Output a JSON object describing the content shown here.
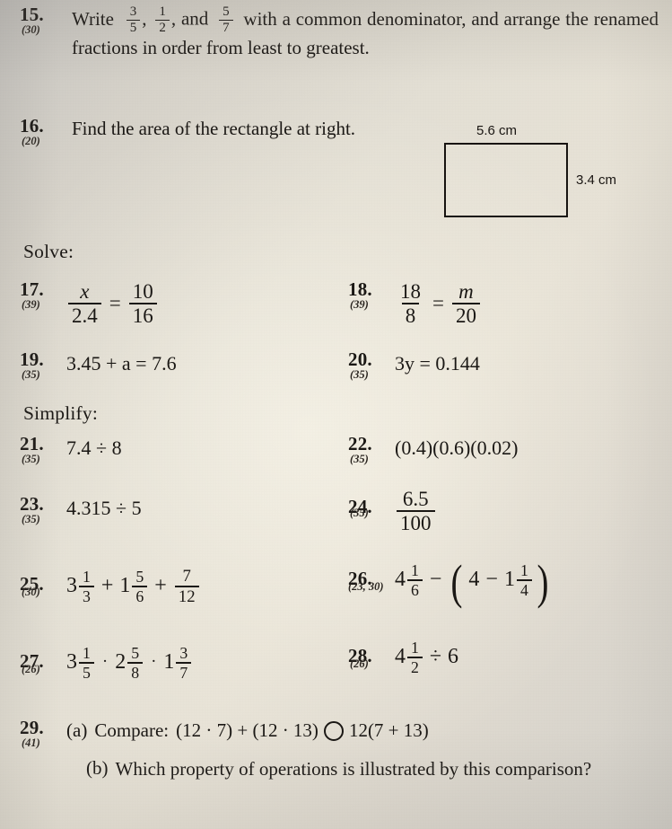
{
  "page": {
    "sections": {
      "solve_heading": "Solve:",
      "simplify_heading": "Simplify:"
    }
  },
  "problems": {
    "p15": {
      "number": "15.",
      "ref": "(30)",
      "text_lead": "Write",
      "frac1": {
        "num": "3",
        "den": "5"
      },
      "sep1": ",",
      "frac2": {
        "num": "1",
        "den": "2"
      },
      "sep2": ", and",
      "frac3": {
        "num": "5",
        "den": "7"
      },
      "text_rest": "with a common denominator, and arrange the renamed fractions in order from least to greatest."
    },
    "p16": {
      "number": "16.",
      "ref": "(20)",
      "text": "Find the area of the rectangle at right.",
      "figure": {
        "top_label": "5.6 cm",
        "right_label": "3.4 cm"
      }
    },
    "p17": {
      "number": "17.",
      "ref": "(39)",
      "lhs": {
        "num": "x",
        "den": "2.4"
      },
      "equals": "=",
      "rhs": {
        "num": "10",
        "den": "16"
      }
    },
    "p18": {
      "number": "18.",
      "ref": "(39)",
      "lhs": {
        "num": "18",
        "den": "8"
      },
      "equals": "=",
      "rhs": {
        "num": "m",
        "den": "20"
      }
    },
    "p19": {
      "number": "19.",
      "ref": "(35)",
      "expr": "3.45 + a = 7.6"
    },
    "p20": {
      "number": "20.",
      "ref": "(35)",
      "expr": "3y = 0.144"
    },
    "p21": {
      "number": "21.",
      "ref": "(35)",
      "expr": "7.4 ÷ 8"
    },
    "p22": {
      "number": "22.",
      "ref": "(35)",
      "expr": "(0.4)(0.6)(0.02)"
    },
    "p23": {
      "number": "23.",
      "ref": "(35)",
      "expr": "4.315 ÷ 5"
    },
    "p24": {
      "number": "24.",
      "ref": "(35)",
      "frac": {
        "num": "6.5",
        "den": "100"
      }
    },
    "p25": {
      "number": "25.",
      "ref": "(30)",
      "t1": {
        "whole": "3",
        "num": "1",
        "den": "3"
      },
      "op1": "+",
      "t2": {
        "whole": "1",
        "num": "5",
        "den": "6"
      },
      "op2": "+",
      "t3": {
        "whole": "",
        "num": "7",
        "den": "12"
      }
    },
    "p26": {
      "number": "26.",
      "ref": "(23, 30)",
      "t1": {
        "whole": "4",
        "num": "1",
        "den": "6"
      },
      "op1": "−",
      "open": "(",
      "inner_whole": "4",
      "op2": "−",
      "t2": {
        "whole": "1",
        "num": "1",
        "den": "4"
      },
      "close": ")"
    },
    "p27": {
      "number": "27.",
      "ref": "(26)",
      "t1": {
        "whole": "3",
        "num": "1",
        "den": "5"
      },
      "op1": "·",
      "t2": {
        "whole": "2",
        "num": "5",
        "den": "8"
      },
      "op2": "·",
      "t3": {
        "whole": "1",
        "num": "3",
        "den": "7"
      }
    },
    "p28": {
      "number": "28.",
      "ref": "(26)",
      "t1": {
        "whole": "4",
        "num": "1",
        "den": "2"
      },
      "op1": "÷",
      "t2": "6"
    },
    "p29": {
      "number": "29.",
      "ref": "(41)",
      "part_a_label": "(a)",
      "part_a_lead": "Compare:",
      "part_a_left": "(12 · 7) + (12 · 13)",
      "part_a_right": "12(7 + 13)",
      "part_b_label": "(b)",
      "part_b_text": "Which property of operations is illustrated by this comparison?"
    }
  },
  "colors": {
    "ink": "#1a1714",
    "paper_light": "#e7e2d6",
    "paper_shadow": "#c6c4c0"
  }
}
